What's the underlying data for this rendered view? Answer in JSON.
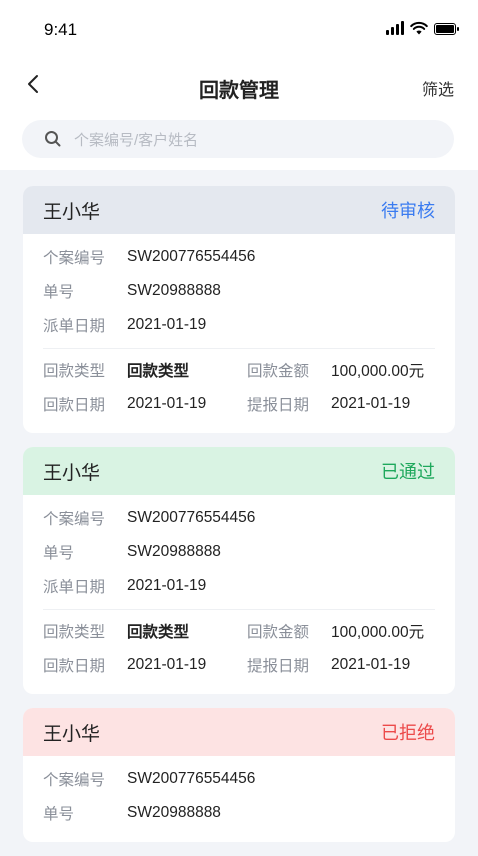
{
  "status_bar": {
    "time": "9:41"
  },
  "nav": {
    "title": "回款管理",
    "filter_label": "筛选"
  },
  "search": {
    "placeholder": "个案编号/客户姓名"
  },
  "labels": {
    "case_no": "个案编号",
    "order_no": "单号",
    "dispatch_date": "派单日期",
    "payback_type": "回款类型",
    "payback_amount": "回款金额",
    "payback_date": "回款日期",
    "report_date": "提报日期"
  },
  "cards": [
    {
      "name": "王小华",
      "status": "待审核",
      "status_color": "#3a7bf0",
      "case_no": "SW200776554456",
      "order_no": "SW20988888",
      "dispatch_date": "2021-01-19",
      "payback_type": "回款类型",
      "payback_amount": "100,000.00元",
      "payback_date": "2021-01-19",
      "report_date": "2021-01-19"
    },
    {
      "name": "王小华",
      "status": "已通过",
      "status_color": "#1ea85c",
      "case_no": "SW200776554456",
      "order_no": "SW20988888",
      "dispatch_date": "2021-01-19",
      "payback_type": "回款类型",
      "payback_amount": "100,000.00元",
      "payback_date": "2021-01-19",
      "report_date": "2021-01-19"
    },
    {
      "name": "王小华",
      "status": "已拒绝",
      "status_color": "#ec4a4a",
      "case_no": "SW200776554456",
      "order_no": "SW20988888"
    }
  ]
}
